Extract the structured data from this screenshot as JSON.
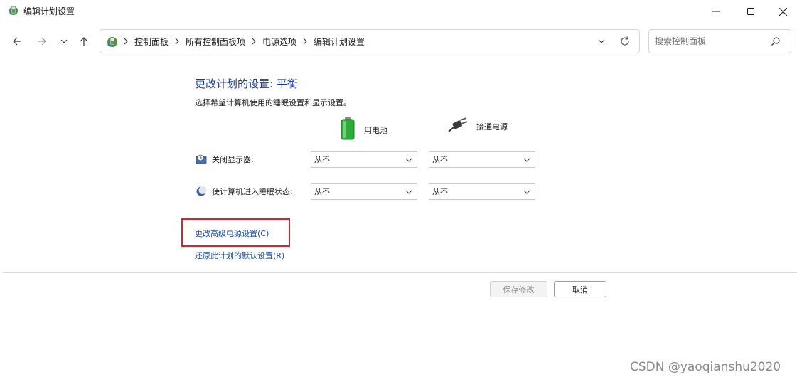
{
  "window": {
    "title": "编辑计划设置",
    "icon": "power-plan-icon"
  },
  "nav": {
    "breadcrumbs": [
      "控制面板",
      "所有控制面板项",
      "电源选项",
      "编辑计划设置"
    ],
    "search_placeholder": "搜索控制面板"
  },
  "content": {
    "title": "更改计划的设置: 平衡",
    "subtitle": "选择希望计算机使用的睡眠设置和显示设置。",
    "columns": {
      "battery": "用电池",
      "plugged_in": "接通电源"
    },
    "rows": [
      {
        "label": "关闭显示器:",
        "battery_value": "从不",
        "plugged_value": "从不",
        "icon": "display-icon"
      },
      {
        "label": "使计算机进入睡眠状态:",
        "battery_value": "从不",
        "plugged_value": "从不",
        "icon": "sleep-moon-icon"
      }
    ],
    "links": {
      "advanced": "更改高级电源设置(C)",
      "restore": "还原此计划的默认设置(R)"
    }
  },
  "buttons": {
    "save": "保存修改",
    "cancel": "取消"
  },
  "watermark": "CSDN @yaoqianshu2020",
  "colors": {
    "title_blue": "#1e3d8f",
    "link_blue": "#1450a5",
    "highlight_red": "#e0202a"
  }
}
